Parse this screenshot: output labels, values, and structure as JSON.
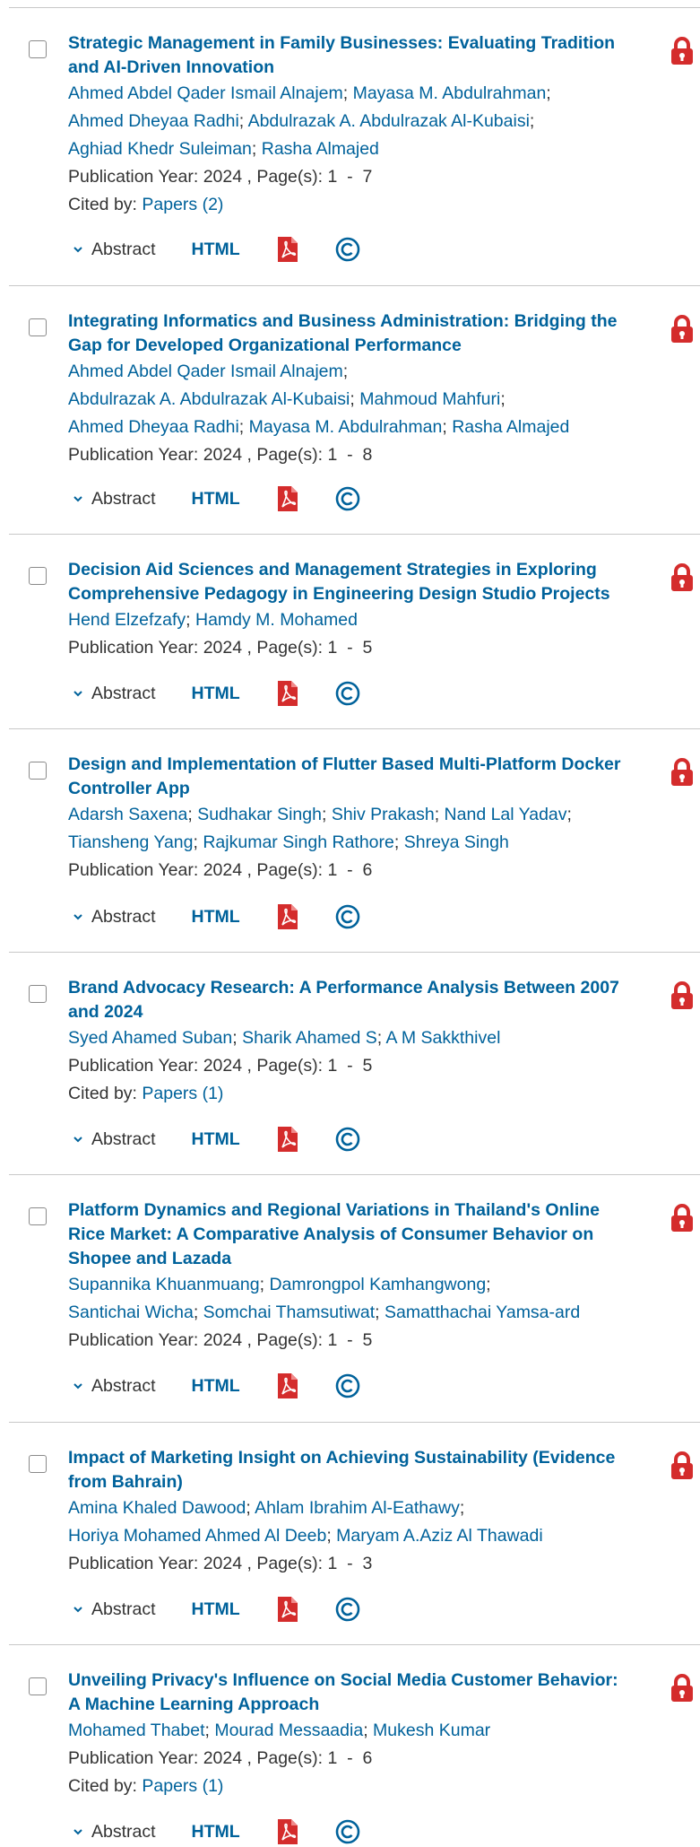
{
  "labels": {
    "publication_year": "Publication Year:",
    "pages": "Page(s):",
    "cited_by": "Cited by:",
    "abstract": "Abstract",
    "html": "HTML"
  },
  "colors": {
    "link": "#00629b",
    "lock": "#d42c2c",
    "pdf": "#d42c2c",
    "divider": "#c8c8c8"
  },
  "icons": {
    "lock": "lock-icon",
    "pdf": "pdf-icon",
    "copyright": "copyright-icon",
    "chevron": "chevron-down-icon"
  },
  "results": [
    {
      "title": "Strategic Management in Family Businesses: Evaluating Tradition and AI-Driven Innovation",
      "authors": [
        "Ahmed Abdel Qader Ismail Alnajem",
        "Mayasa M. Abdulrahman",
        "Ahmed Dheyaa Radhi",
        "Abdulrazak A. Abdulrazak Al-Kubaisi",
        "Aghiad Khedr Suleiman",
        "Rasha Almajed"
      ],
      "author_lines": [
        [
          0,
          1
        ],
        [
          2,
          3
        ],
        [
          4,
          5
        ]
      ],
      "year": "2024",
      "pages": "1  -  7",
      "cited": "Papers (2)"
    },
    {
      "title": "Integrating Informatics and Business Administration: Bridging the Gap for Developed Organizational Performance",
      "authors": [
        "Ahmed Abdel Qader Ismail Alnajem",
        "Abdulrazak A. Abdulrazak Al-Kubaisi",
        "Mahmoud Mahfuri",
        "Ahmed Dheyaa Radhi",
        "Mayasa M. Abdulrahman",
        "Rasha Almajed"
      ],
      "author_lines": [
        [
          0
        ],
        [
          1,
          2
        ],
        [
          3,
          4,
          5
        ]
      ],
      "year": "2024",
      "pages": "1  -  8",
      "cited": null
    },
    {
      "title": "Decision Aid Sciences and Management Strategies in Exploring Comprehensive Pedagogy in Engineering Design Studio Projects",
      "authors": [
        "Hend Elzefzafy",
        "Hamdy M. Mohamed"
      ],
      "author_lines": [
        [
          0,
          1
        ]
      ],
      "year": "2024",
      "pages": "1  -  5",
      "cited": null
    },
    {
      "title": "Design and Implementation of Flutter Based Multi-Platform Docker Controller App",
      "authors": [
        "Adarsh Saxena",
        "Sudhakar Singh",
        "Shiv Prakash",
        "Nand Lal Yadav",
        "Tiansheng Yang",
        "Rajkumar Singh Rathore",
        "Shreya Singh"
      ],
      "author_lines": [
        [
          0,
          1,
          2,
          3
        ],
        [
          4,
          5,
          6
        ]
      ],
      "year": "2024",
      "pages": "1  -  6",
      "cited": null
    },
    {
      "title": "Brand Advocacy Research: A Performance Analysis Between 2007 and 2024",
      "authors": [
        "Syed Ahamed Suban",
        "Sharik Ahamed S",
        "A M Sakkthivel"
      ],
      "author_lines": [
        [
          0,
          1,
          2
        ]
      ],
      "year": "2024",
      "pages": "1  -  5",
      "cited": "Papers (1)"
    },
    {
      "title": "Platform Dynamics and Regional Variations in Thailand's Online Rice Market: A Comparative Analysis of Consumer Behavior on Shopee and Lazada",
      "authors": [
        "Supannika Khuanmuang",
        "Damrongpol Kamhangwong",
        "Santichai Wicha",
        "Somchai Thamsutiwat",
        "Samatthachai Yamsa-ard"
      ],
      "author_lines": [
        [
          0,
          1
        ],
        [
          2,
          3,
          4
        ]
      ],
      "year": "2024",
      "pages": "1  -  5",
      "cited": null
    },
    {
      "title": "Impact of Marketing Insight on Achieving Sustainability (Evidence from Bahrain)",
      "authors": [
        "Amina Khaled Dawood",
        "Ahlam Ibrahim Al-Eathawy",
        "Horiya Mohamed Ahmed Al Deeb",
        "Maryam A.Aziz Al Thawadi"
      ],
      "author_lines": [
        [
          0,
          1
        ],
        [
          2,
          3
        ]
      ],
      "year": "2024",
      "pages": "1  -  3",
      "cited": null
    },
    {
      "title": "Unveiling Privacy's Influence on Social Media Customer Behavior: A Machine Learning Approach",
      "authors": [
        "Mohamed Thabet",
        "Mourad Messaadia",
        "Mukesh Kumar"
      ],
      "author_lines": [
        [
          0,
          1,
          2
        ]
      ],
      "year": "2024",
      "pages": "1  -  6",
      "cited": "Papers (1)"
    }
  ]
}
